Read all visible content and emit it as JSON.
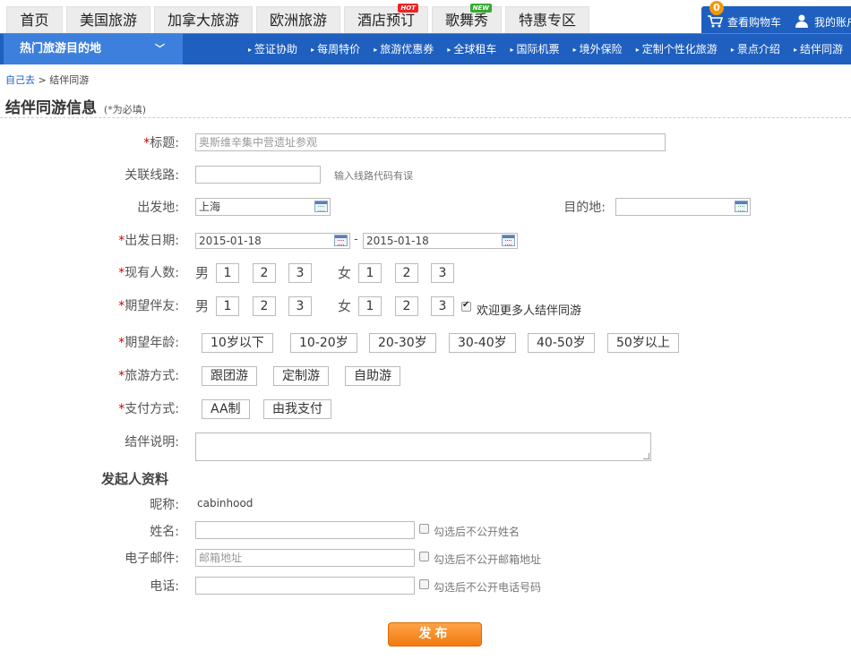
{
  "top_tabs": [
    {
      "label": "首页"
    },
    {
      "label": "美国旅游"
    },
    {
      "label": "加拿大旅游"
    },
    {
      "label": "欧洲旅游"
    },
    {
      "label": "酒店预订",
      "badge": "HOT"
    },
    {
      "label": "歌舞秀",
      "badge": "NEW"
    },
    {
      "label": "特惠专区"
    }
  ],
  "cart": {
    "count": "0",
    "label": "查看购物车",
    "account_label": "我的账户"
  },
  "hot_destinations": {
    "label": "热门旅游目的地",
    "icon": "chevron-down-icon"
  },
  "nav_links": [
    "签证协助",
    "每周特价",
    "旅游优惠券",
    "全球租车",
    "国际机票",
    "境外保险",
    "定制个性化旅游",
    "景点介绍",
    "结伴同游"
  ],
  "breadcrumb": {
    "home": "自己去",
    "separator": ">",
    "current": "结伴同游"
  },
  "page_title": "结伴同游信息",
  "required_note": "(*为必填)",
  "form": {
    "title_label": "标题:",
    "title_placeholder": "奥斯维辛集中营遗址参观",
    "route_label": "关联线路:",
    "route_value": "",
    "route_hint": "输入线路代码有误",
    "depart_label": "出发地:",
    "depart_value": "上海",
    "dest_label": "目的地:",
    "dest_value": "",
    "date_label": "出发日期:",
    "date_start": "2015-01-18",
    "date_sep": "-",
    "date_end": "2015-01-18",
    "current_people_label": "现有人数:",
    "male_label": "男",
    "female_label": "女",
    "counts": [
      "1",
      "2",
      "3"
    ],
    "expected_companions_label": "期望伴友:",
    "welcome_more_label": "欢迎更多人结伴同游",
    "welcome_more_checked": true,
    "age_label": "期望年龄:",
    "age_options": [
      "10岁以下",
      "10-20岁",
      "20-30岁",
      "30-40岁",
      "40-50岁",
      "50岁以上"
    ],
    "travel_mode_label": "旅游方式:",
    "travel_modes": [
      "跟团游",
      "定制游",
      "自助游"
    ],
    "payment_label": "支付方式:",
    "payment_options": [
      "AA制",
      "由我支付"
    ],
    "desc_label": "结伴说明:",
    "desc_value": ""
  },
  "initiator": {
    "section_title": "发起人资料",
    "nickname_label": "昵称:",
    "nickname_value": "cabinhood",
    "name_label": "姓名:",
    "name_hint": "勾选后不公开姓名",
    "email_label": "电子邮件:",
    "email_placeholder": "邮箱地址",
    "email_hint": "勾选后不公开邮箱地址",
    "phone_label": "电话:",
    "phone_hint": "勾选后不公开电话号码"
  },
  "submit_label": "发布",
  "colors": {
    "brand_blue": "#1e5fbf",
    "accent_orange": "#f07a10",
    "required_red": "#cc0000"
  }
}
